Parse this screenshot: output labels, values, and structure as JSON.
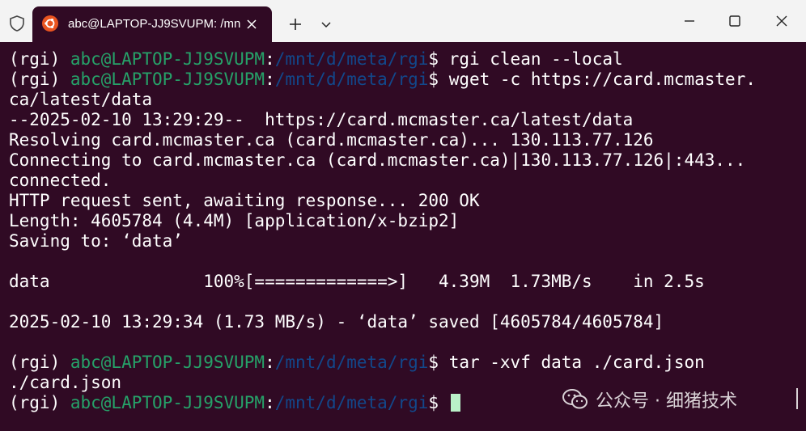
{
  "titlebar": {
    "tab_title": "abc@LAPTOP-JJ9SVUPM: /mn",
    "new_tab_icon": "plus-icon",
    "dropdown_icon": "chevron-down-icon",
    "colors": {
      "titlebar_bg": "#f3f3f3",
      "tab_bg": "#300a24",
      "ubuntu_orange": "#e95420"
    }
  },
  "terminal": {
    "colors": {
      "background": "#300a24",
      "foreground": "#ffffff",
      "user_host": "#26a269",
      "path": "#12488b",
      "cursor": "#b9f0c8"
    },
    "prompt": {
      "env": "(rgi) ",
      "user_host": "abc@LAPTOP-JJ9SVUPM",
      "colon": ":",
      "path": "/mnt/d/meta/rgi",
      "dollar": "$ "
    },
    "commands": {
      "cmd1": "rgi clean --local",
      "cmd2": "wget -c https://card.mcmaster.",
      "cmd3": "tar -xvf data ./card.json"
    },
    "output": {
      "l3": "ca/latest/data",
      "l4": "--2025-02-10 13:29:29--  https://card.mcmaster.ca/latest/data",
      "l5": "Resolving card.mcmaster.ca (card.mcmaster.ca)... 130.113.77.126",
      "l6": "Connecting to card.mcmaster.ca (card.mcmaster.ca)|130.113.77.126|:443...",
      "l7": "connected.",
      "l8": "HTTP request sent, awaiting response... 200 OK",
      "l9": "Length: 4605784 (4.4M) [application/x-bzip2]",
      "l10": "Saving to: ‘data’",
      "l12": "data               100%[=============>]   4.39M  1.73MB/s    in 2.5s",
      "l14": "2025-02-10 13:29:34 (1.73 MB/s) - ‘data’ saved [4605784/4605784]",
      "l17": "./card.json"
    }
  },
  "watermark": {
    "text": "公众号 · 细猪技术",
    "icon": "wechat-icon"
  }
}
